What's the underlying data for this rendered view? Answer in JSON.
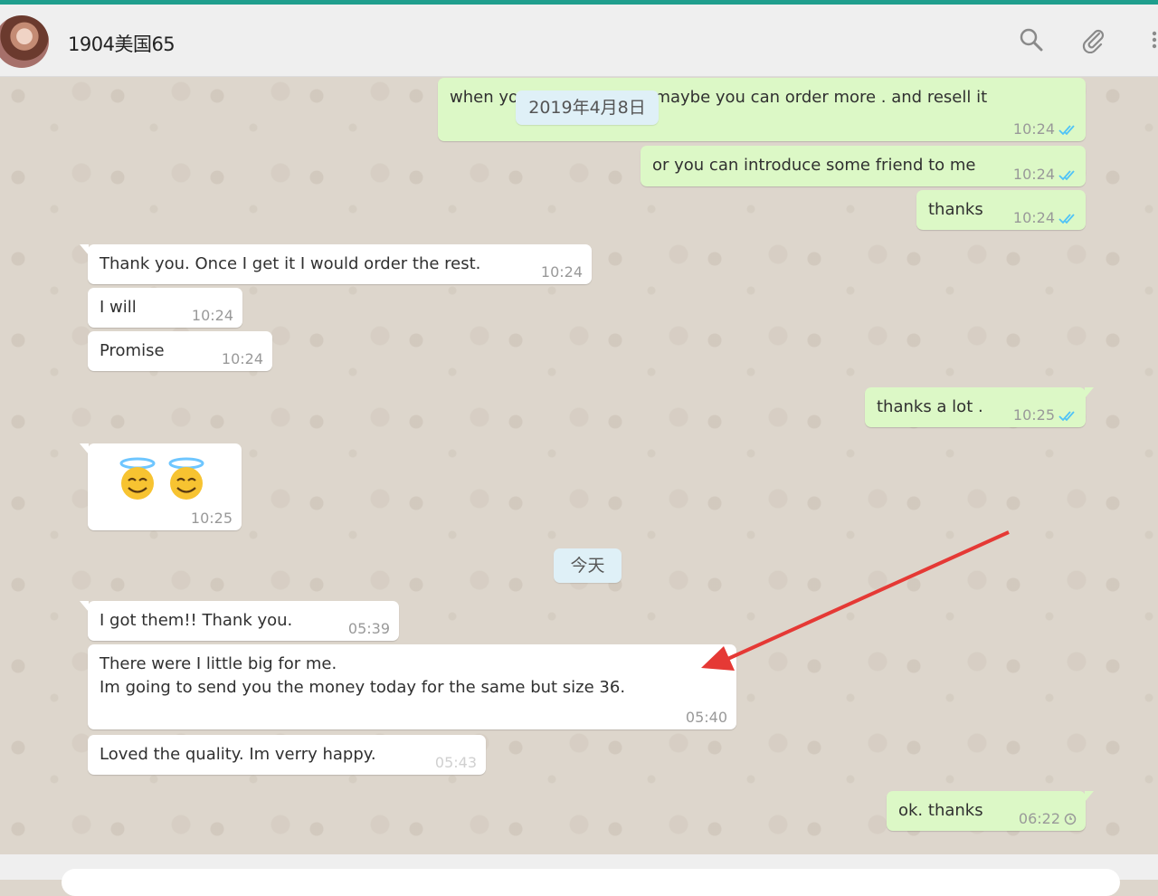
{
  "header": {
    "contact_name": "1904美国65",
    "icons": [
      "search-icon",
      "paperclip-icon",
      "menu-icon"
    ]
  },
  "colors": {
    "accent": "#1f9e8d",
    "outgoing_bubble": "#dcf8c6",
    "incoming_bubble": "#ffffff",
    "read_ticks": "#4fc3f7",
    "annotation_arrow": "#e53935"
  },
  "date_chips": {
    "first": "2019年4月8日",
    "today": "今天"
  },
  "messages": {
    "m1": {
      "text": "when yo                      r . maybe you can order more . and resell it",
      "time": "10:24",
      "status": "read"
    },
    "m2": {
      "text": "or you can introduce some friend to me",
      "time": "10:24",
      "status": "read"
    },
    "m3": {
      "text": "thanks",
      "time": "10:24",
      "status": "read"
    },
    "m4": {
      "text": "Thank you. Once I get it I would order the rest.",
      "time": "10:24"
    },
    "m5": {
      "text": "I will",
      "time": "10:24"
    },
    "m6": {
      "text": "Promise",
      "time": "10:24"
    },
    "m7": {
      "text": "thanks a lot .",
      "time": "10:25",
      "status": "read"
    },
    "m8": {
      "emoji": "smiling-face-with-halo x2",
      "time": "10:25"
    },
    "m9": {
      "text": "I got them!! Thank you.",
      "time": "05:39"
    },
    "m10": {
      "line1": "There were I little big for me.",
      "line2": "Im going to send you the money today for the same but size 36.",
      "time": "05:40"
    },
    "m11": {
      "text": "Loved the quality. Im verry happy.",
      "time": "05:43"
    },
    "m12": {
      "text": "ok. thanks",
      "time": "06:22",
      "status": "pending"
    }
  }
}
